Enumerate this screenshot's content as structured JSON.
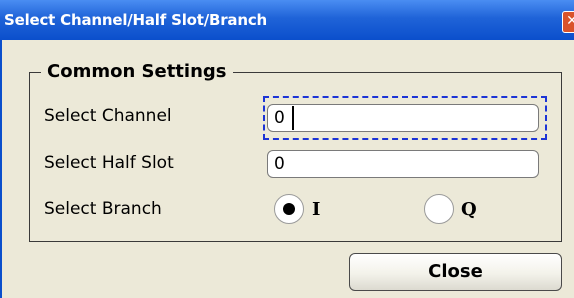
{
  "window": {
    "title": "Select Channel/Half Slot/Branch",
    "close_icon_glyph": "✕"
  },
  "group": {
    "legend": "Common Settings"
  },
  "fields": {
    "channel": {
      "label": "Select Channel",
      "value": "0",
      "focused": true
    },
    "half_slot": {
      "label": "Select Half Slot",
      "value": "0"
    }
  },
  "branch": {
    "label": "Select Branch",
    "options": [
      {
        "label": "I",
        "selected": true
      },
      {
        "label": "Q",
        "selected": false
      }
    ]
  },
  "buttons": {
    "close_label": "Close"
  },
  "colors": {
    "title_bar": "#0b4fcc",
    "focus_ring": "#1c34d6",
    "dialog_bg": "#ece9d8"
  }
}
